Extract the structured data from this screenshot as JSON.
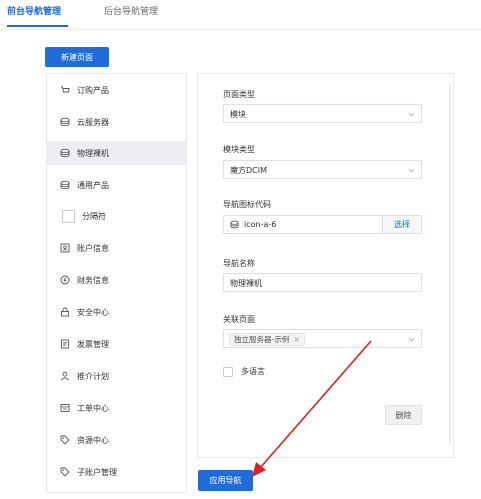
{
  "tabs": [
    {
      "label": "前台导航管理",
      "active": true
    },
    {
      "label": "后台导航管理",
      "active": false
    }
  ],
  "new_page_button": "新建页面",
  "sidebar": {
    "items": [
      {
        "label": "订购产品",
        "icon": "cart-icon"
      },
      {
        "label": "云服务器",
        "icon": "server-icon"
      },
      {
        "label": "物理裸机",
        "icon": "server-icon",
        "active": true
      },
      {
        "label": "通用产品",
        "icon": "server-icon"
      },
      {
        "label": "分隔符",
        "icon": "checkbox"
      },
      {
        "label": "账户信息",
        "icon": "id-card-icon"
      },
      {
        "label": "财务信息",
        "icon": "coin-icon"
      },
      {
        "label": "安全中心",
        "icon": "lock-icon"
      },
      {
        "label": "发票管理",
        "icon": "invoice-icon"
      },
      {
        "label": "推介计划",
        "icon": "user-icon"
      },
      {
        "label": "工单中心",
        "icon": "ticket-icon"
      },
      {
        "label": "资源中心",
        "icon": "tag-icon"
      },
      {
        "label": "子账户管理",
        "icon": "tag-icon"
      }
    ]
  },
  "form": {
    "page_type_label": "页面类型",
    "page_type_value": "模块",
    "module_type_label": "模块类型",
    "module_type_value": "魔方DCIM",
    "icon_code_label": "导航图标代码",
    "icon_code_value": "icon-a-6",
    "icon_select_button": "选择",
    "nav_name_label": "导航名称",
    "nav_name_value": "物理裸机",
    "linked_page_label": "关联页面",
    "linked_page_tag": "独立服务器-示例",
    "multilang_label": "多语言",
    "delete_button": "删除"
  },
  "apply_button": "应用导航",
  "colors": {
    "primary": "#1f6bd9",
    "annotation_arrow": "#e02020"
  }
}
